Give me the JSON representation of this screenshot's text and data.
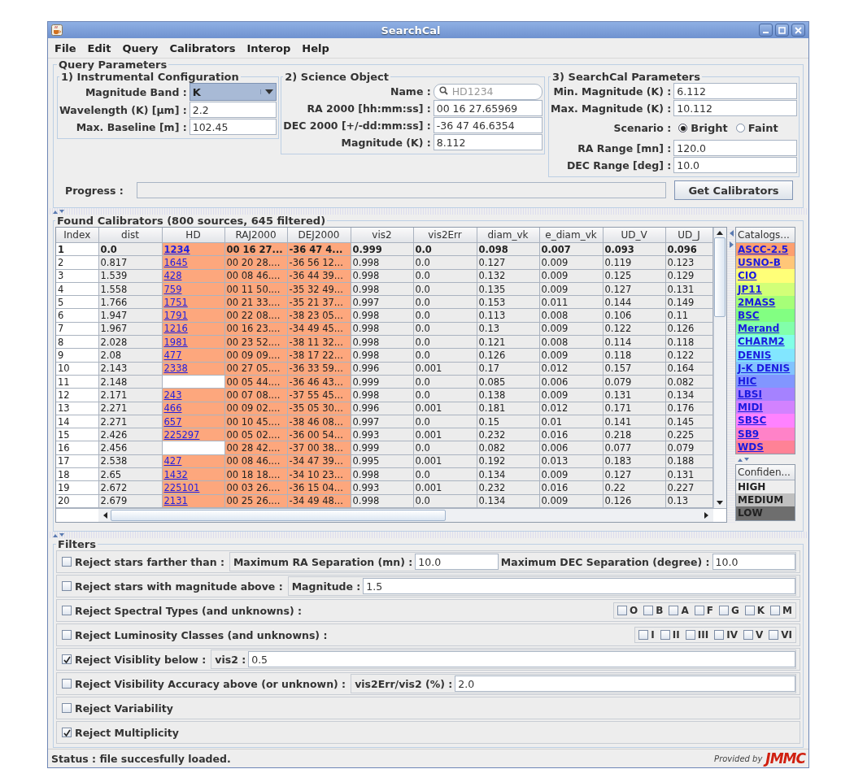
{
  "window": {
    "title": "SearchCal"
  },
  "menu": [
    "File",
    "Edit",
    "Query",
    "Calibrators",
    "Interop",
    "Help"
  ],
  "query_parameters": {
    "title": "Query Parameters",
    "groups": [
      {
        "title": "1)  Instrumental Configuration",
        "fields": [
          {
            "label": "Magnitude Band :",
            "kind": "dropdown",
            "value": "K"
          },
          {
            "label": "Wavelength (K) [µm] :",
            "kind": "text",
            "value": "2.2"
          },
          {
            "label": "Max. Baseline [m] :",
            "kind": "text",
            "value": "102.45"
          }
        ]
      },
      {
        "title": "2)  Science Object",
        "fields": [
          {
            "label": "Name :",
            "kind": "search",
            "placeholder": "HD1234"
          },
          {
            "label": "RA 2000 [hh:mm:ss] :",
            "kind": "text",
            "value": "00 16 27.65969"
          },
          {
            "label": "DEC 2000 [+/-dd:mm:ss] :",
            "kind": "text",
            "value": "-36 47 46.6354"
          },
          {
            "label": "Magnitude (K) :",
            "kind": "text",
            "value": "8.112"
          }
        ]
      },
      {
        "title": "3)  SearchCal Parameters",
        "fields": [
          {
            "label": "Min. Magnitude (K) :",
            "kind": "text",
            "value": "6.112"
          },
          {
            "label": "Max. Magnitude (K) :",
            "kind": "text",
            "value": "10.112"
          },
          {
            "label": "Scenario :",
            "kind": "radio",
            "options": [
              {
                "label": "Bright",
                "selected": true
              },
              {
                "label": "Faint",
                "selected": false
              }
            ]
          },
          {
            "label": "RA Range [mn] :",
            "kind": "text",
            "value": "120.0"
          },
          {
            "label": "DEC Range [deg] :",
            "kind": "text",
            "value": "10.0"
          }
        ]
      }
    ],
    "progress": {
      "label": "Progress :",
      "level": 0
    },
    "button": "Get Calibrators"
  },
  "results": {
    "title": "Found Calibrators (800 sources, 645 filtered)",
    "columns": [
      {
        "label": "Index",
        "kind": "index"
      },
      {
        "label": "dist",
        "kind": "number"
      },
      {
        "label": "HD",
        "kind": "link",
        "color": "#fda77d"
      },
      {
        "label": "RAJ2000",
        "kind": "number",
        "color": "#fda77d"
      },
      {
        "label": "DEJ2000",
        "kind": "number",
        "color": "#fda77d"
      },
      {
        "label": "vis2",
        "kind": "number"
      },
      {
        "label": "vis2Err",
        "kind": "number"
      },
      {
        "label": "diam_vk",
        "kind": "number"
      },
      {
        "label": "e_diam_vk",
        "kind": "number"
      },
      {
        "label": "UD_V",
        "kind": "number"
      },
      {
        "label": "UD_J",
        "kind": "number"
      }
    ],
    "rows": [
      {
        "kind": "science",
        "cells": [
          "1",
          "0.0",
          "1234",
          "00 16 27...",
          "-36 47 4...",
          "0.999",
          "0.0",
          "0.098",
          "0.007",
          "0.093",
          "0.096"
        ]
      },
      {
        "kind": "calibrator",
        "cells": [
          "2",
          "0.817",
          "1645",
          "00 20 28....",
          "-36 56 12...",
          "0.998",
          "0.0",
          "0.127",
          "0.009",
          "0.119",
          "0.123"
        ]
      },
      {
        "kind": "calibrator",
        "cells": [
          "3",
          "1.539",
          "428",
          "00 08 46....",
          "-36 44 39...",
          "0.998",
          "0.0",
          "0.132",
          "0.009",
          "0.125",
          "0.129"
        ]
      },
      {
        "kind": "calibrator",
        "cells": [
          "4",
          "1.558",
          "759",
          "00 11 50....",
          "-35 32 49...",
          "0.998",
          "0.0",
          "0.135",
          "0.009",
          "0.127",
          "0.131"
        ]
      },
      {
        "kind": "calibrator",
        "cells": [
          "5",
          "1.766",
          "1751",
          "00 21 33....",
          "-35 21 37...",
          "0.997",
          "0.0",
          "0.153",
          "0.011",
          "0.144",
          "0.149"
        ]
      },
      {
        "kind": "calibrator",
        "cells": [
          "6",
          "1.947",
          "1791",
          "00 22 08....",
          "-38 23 05...",
          "0.998",
          "0.0",
          "0.113",
          "0.008",
          "0.106",
          "0.11"
        ]
      },
      {
        "kind": "calibrator",
        "cells": [
          "7",
          "1.967",
          "1216",
          "00 16 23....",
          "-34 49 45...",
          "0.998",
          "0.0",
          "0.13",
          "0.009",
          "0.122",
          "0.126"
        ]
      },
      {
        "kind": "calibrator",
        "cells": [
          "8",
          "2.028",
          "1981",
          "00 23 52....",
          "-38 11 32...",
          "0.998",
          "0.0",
          "0.121",
          "0.008",
          "0.114",
          "0.118"
        ]
      },
      {
        "kind": "calibrator",
        "cells": [
          "9",
          "2.08",
          "477",
          "00 09 09....",
          "-38 17 22...",
          "0.998",
          "0.0",
          "0.126",
          "0.009",
          "0.118",
          "0.122"
        ]
      },
      {
        "kind": "calibrator",
        "cells": [
          "10",
          "2.143",
          "2338",
          "00 27 05....",
          "-36 33 59...",
          "0.996",
          "0.001",
          "0.17",
          "0.012",
          "0.157",
          "0.164"
        ]
      },
      {
        "kind": "calibrator",
        "cells": [
          "11",
          "2.148",
          null,
          "00 05 44....",
          "-36 46 43...",
          "0.999",
          "0.0",
          "0.085",
          "0.006",
          "0.079",
          "0.082"
        ]
      },
      {
        "kind": "calibrator",
        "cells": [
          "12",
          "2.171",
          "243",
          "00 07 08....",
          "-37 55 45...",
          "0.998",
          "0.0",
          "0.138",
          "0.009",
          "0.131",
          "0.134"
        ]
      },
      {
        "kind": "calibrator",
        "cells": [
          "13",
          "2.271",
          "466",
          "00 09 02....",
          "-35 05 30...",
          "0.996",
          "0.001",
          "0.181",
          "0.012",
          "0.171",
          "0.176"
        ]
      },
      {
        "kind": "calibrator",
        "cells": [
          "14",
          "2.271",
          "657",
          "00 10 45....",
          "-38 46 08...",
          "0.997",
          "0.0",
          "0.15",
          "0.01",
          "0.141",
          "0.145"
        ]
      },
      {
        "kind": "calibrator",
        "cells": [
          "15",
          "2.426",
          "225297",
          "00 05 02....",
          "-36 00 54...",
          "0.993",
          "0.001",
          "0.232",
          "0.016",
          "0.218",
          "0.225"
        ]
      },
      {
        "kind": "calibrator",
        "cells": [
          "16",
          "2.456",
          null,
          "00 28 42....",
          "-37 00 38...",
          "0.999",
          "0.0",
          "0.082",
          "0.006",
          "0.077",
          "0.079"
        ]
      },
      {
        "kind": "calibrator",
        "cells": [
          "17",
          "2.538",
          "427",
          "00 08 46....",
          "-34 47 39...",
          "0.995",
          "0.001",
          "0.192",
          "0.013",
          "0.183",
          "0.188"
        ]
      },
      {
        "kind": "calibrator",
        "cells": [
          "18",
          "2.65",
          "1432",
          "00 18 18....",
          "-34 10 23...",
          "0.998",
          "0.0",
          "0.134",
          "0.009",
          "0.127",
          "0.131"
        ]
      },
      {
        "kind": "calibrator",
        "cells": [
          "19",
          "2.672",
          "225101",
          "00 03 26....",
          "-36 15 04...",
          "0.993",
          "0.001",
          "0.232",
          "0.016",
          "0.22",
          "0.227"
        ]
      },
      {
        "kind": "calibrator",
        "cells": [
          "20",
          "2.679",
          "2131",
          "00 25 26....",
          "-34 49 48...",
          "0.998",
          "0.0",
          "0.134",
          "0.009",
          "0.126",
          "0.13"
        ]
      }
    ]
  },
  "catalogs": {
    "title": "Catalogs...",
    "items": [
      {
        "name": "ASCC-2.5",
        "color": "#fd9f6f"
      },
      {
        "name": "USNO-B",
        "color": "#ffc678"
      },
      {
        "name": "CIO",
        "color": "#ffff78"
      },
      {
        "name": "JP11",
        "color": "#d2ff78"
      },
      {
        "name": "2MASS",
        "color": "#a6ff78"
      },
      {
        "name": "BSC",
        "color": "#82ff82"
      },
      {
        "name": "Merand",
        "color": "#82ffaa"
      },
      {
        "name": "CHARM2",
        "color": "#82ffe6"
      },
      {
        "name": "DENIS",
        "color": "#82e6ff"
      },
      {
        "name": "J-K DENIS",
        "color": "#82c3ff"
      },
      {
        "name": "HIC",
        "color": "#8296ff"
      },
      {
        "name": "LBSI",
        "color": "#a582ff"
      },
      {
        "name": "MIDI",
        "color": "#d282ff"
      },
      {
        "name": "SBSC",
        "color": "#ff82ff"
      },
      {
        "name": "SB9",
        "color": "#ff82c8"
      },
      {
        "name": "WDS",
        "color": "#ff8296"
      }
    ]
  },
  "confidence": {
    "title": "Confiden...",
    "items": [
      {
        "name": "HIGH",
        "color": "#eeeeee"
      },
      {
        "name": "MEDIUM",
        "color": "#c0c0c0"
      },
      {
        "name": "LOW",
        "color": "#6e6e6e"
      }
    ]
  },
  "filters": {
    "title": "Filters",
    "items": [
      {
        "label": "Reject stars farther than :",
        "checked": false,
        "kind": "fields",
        "fields": [
          {
            "label": "Maximum RA Separation (mn) :",
            "value": "10.0"
          },
          {
            "label": "Maximum DEC Separation (degree) :",
            "value": "10.0"
          }
        ]
      },
      {
        "label": "Reject stars with magnitude above :",
        "checked": false,
        "kind": "fields",
        "fields": [
          {
            "label": "Magnitude :",
            "value": "1.5"
          }
        ]
      },
      {
        "label": "Reject Spectral Types (and unknowns) :",
        "checked": false,
        "kind": "options",
        "options": [
          {
            "label": "O",
            "checked": false
          },
          {
            "label": "B",
            "checked": false
          },
          {
            "label": "A",
            "checked": false
          },
          {
            "label": "F",
            "checked": false
          },
          {
            "label": "G",
            "checked": false
          },
          {
            "label": "K",
            "checked": false
          },
          {
            "label": "M",
            "checked": false
          }
        ]
      },
      {
        "label": "Reject Luminosity Classes (and unknowns) :",
        "checked": false,
        "kind": "options",
        "options": [
          {
            "label": "I",
            "checked": false
          },
          {
            "label": "II",
            "checked": false
          },
          {
            "label": "III",
            "checked": false
          },
          {
            "label": "IV",
            "checked": false
          },
          {
            "label": "V",
            "checked": false
          },
          {
            "label": "VI",
            "checked": false
          }
        ]
      },
      {
        "label": "Reject Visiblity below :",
        "checked": true,
        "kind": "fields",
        "fields": [
          {
            "label": "vis2 :",
            "value": "0.5"
          }
        ]
      },
      {
        "label": "Reject Visibility Accuracy above (or unknown) :",
        "checked": false,
        "kind": "fields",
        "fields": [
          {
            "label": "vis2Err/vis2 (%) :",
            "value": "2.0"
          }
        ]
      },
      {
        "label": "Reject Variability",
        "checked": false,
        "kind": "plain"
      },
      {
        "label": "Reject Multiplicity",
        "checked": true,
        "kind": "plain"
      }
    ]
  },
  "status_bar": {
    "text": "Status : file succesfully loaded.",
    "credit": "Provided by",
    "logo": "JMMC"
  }
}
